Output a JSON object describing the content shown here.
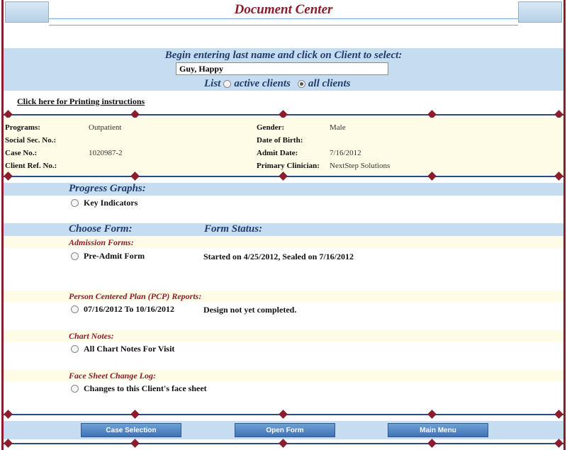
{
  "header": {
    "title": "Document Center"
  },
  "search": {
    "prompt": "Begin entering last name and click on Client to select:",
    "client_value": "Guy, Happy",
    "list_label": "List",
    "active_label": "active clients",
    "all_label": "all clients",
    "selected": "all clients"
  },
  "print_link": "Click here for Printing instructions",
  "client": {
    "programs_label": "Programs:",
    "programs_value": "Outpatient",
    "ssn_label": "Social Sec. No.:",
    "ssn_value": "",
    "case_label": "Case No.:",
    "case_value": "1020987-2",
    "ref_label": "Client Ref. No.:",
    "ref_value": "",
    "gender_label": "Gender:",
    "gender_value": "Male",
    "dob_label": "Date of Birth:",
    "dob_value": "",
    "admit_label": "Admit Date:",
    "admit_value": "7/16/2012",
    "clinician_label": "Primary Clinician:",
    "clinician_value": "NextStep Solutions"
  },
  "progress": {
    "title": "Progress Graphs:",
    "option": "Key Indicators"
  },
  "forms": {
    "choose_title": "Choose Form:",
    "status_title": "Form Status:",
    "categories": [
      {
        "title": "Admission Forms:",
        "option": "Pre-Admit Form",
        "status": "Started on 4/25/2012, Sealed on 7/16/2012"
      },
      {
        "title": "Person Centered Plan (PCP) Reports:",
        "option": "07/16/2012 To 10/16/2012",
        "status": "Design not yet completed."
      },
      {
        "title": "Chart Notes:",
        "option": "All Chart Notes For Visit",
        "status": ""
      },
      {
        "title": "Face Sheet Change Log:",
        "option": "Changes to this Client's face sheet",
        "status": ""
      }
    ]
  },
  "buttons": {
    "case_selection": "Case Selection",
    "open_form": "Open Form",
    "main_menu": "Main Menu"
  },
  "colors": {
    "accent_red": "#8b1d2c",
    "band_blue": "#c6dcf0",
    "info_yellow": "#fefce6",
    "button_blue": "#3f73b5"
  }
}
